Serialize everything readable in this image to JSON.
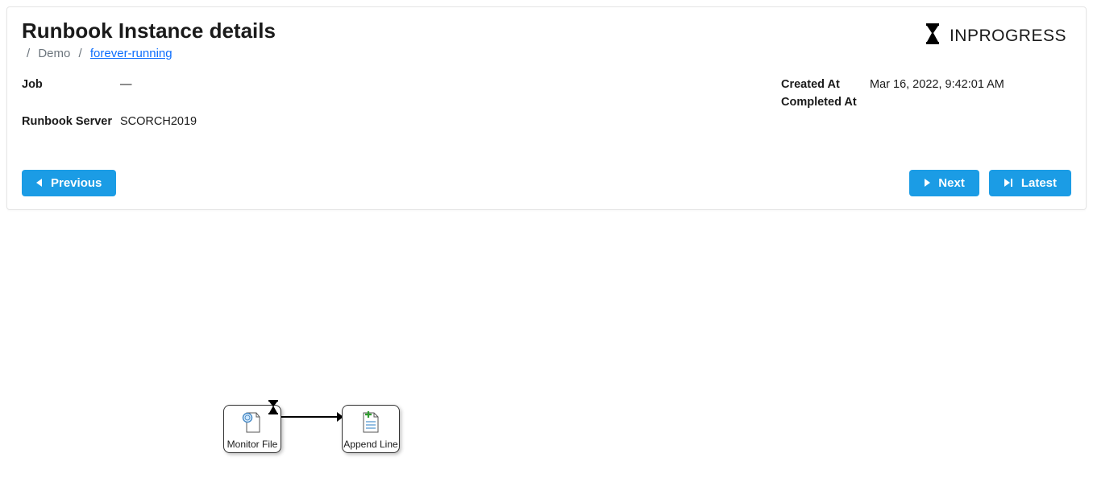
{
  "header": {
    "title": "Runbook Instance details",
    "breadcrumb": {
      "item1": "Demo",
      "item2": "forever-running"
    },
    "status": "INPROGRESS"
  },
  "details": {
    "left": {
      "job_label": "Job",
      "job_value": "—",
      "server_label": "Runbook Server",
      "server_value": "SCORCH2019"
    },
    "right": {
      "created_label": "Created At",
      "created_value": "Mar 16, 2022, 9:42:01 AM",
      "completed_label": "Completed At",
      "completed_value": ""
    }
  },
  "buttons": {
    "previous": "Previous",
    "next": "Next",
    "latest": "Latest"
  },
  "diagram": {
    "nodes": [
      {
        "label": "Monitor File"
      },
      {
        "label": "Append Line"
      }
    ]
  }
}
